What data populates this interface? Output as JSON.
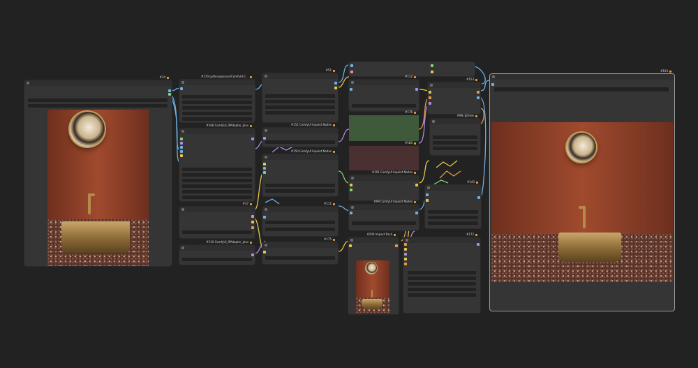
{
  "nodes": {
    "load_image": {
      "title": "#34"
    },
    "python_goss": {
      "title": "#170 pythongosssss/ComfyUI-C..."
    },
    "ipadapter_1": {
      "title": "#168 ComfyUI_IPAdapter_plus"
    },
    "node_37": {
      "title": "#37"
    },
    "ipadapter_2": {
      "title": "#110 ComfyUI_IPAdapter_plus"
    },
    "node_51": {
      "title": "#51"
    },
    "inpaint_151": {
      "title": "#151 ComfyUI Inpaint Nodes"
    },
    "inpaint_150": {
      "title": "#150 ComfyUI Inpaint Nodes"
    },
    "node_111": {
      "title": "#111"
    },
    "node_175": {
      "title": "#175"
    },
    "node_112": {
      "title": "#112"
    },
    "node_176": {
      "title": "#176"
    },
    "node_180": {
      "title": "#180"
    },
    "inpaint_301": {
      "title": "#301 ComfyUI Inpaint Nodes"
    },
    "inpaint_99": {
      "title": "#99 ComfyUI Inpaint Nodes"
    },
    "impact_pack": {
      "title": "#200 Impact Pack"
    },
    "node_153": {
      "title": "#153"
    },
    "rgthree": {
      "title": "#98 rgthree"
    },
    "node_143": {
      "title": "#143"
    },
    "node_172": {
      "title": "#172"
    },
    "save_image": {
      "title": "#104"
    }
  },
  "colors": {
    "canvas": "#222222",
    "node": "#353535",
    "widget": "#222222",
    "green_group": "#3f5a3a",
    "pink_group": "#4a3030",
    "wire_blue": "#6fb0e6",
    "wire_yellow": "#e6c84a",
    "wire_purple": "#b08ae6",
    "wire_orange": "#e69a4a",
    "wire_green": "#7ed37e",
    "wire_pink": "#e68ab0",
    "wire_cyan": "#5ad0d0"
  },
  "icons": [
    "lock-icon",
    "collapse-dot-icon"
  ]
}
